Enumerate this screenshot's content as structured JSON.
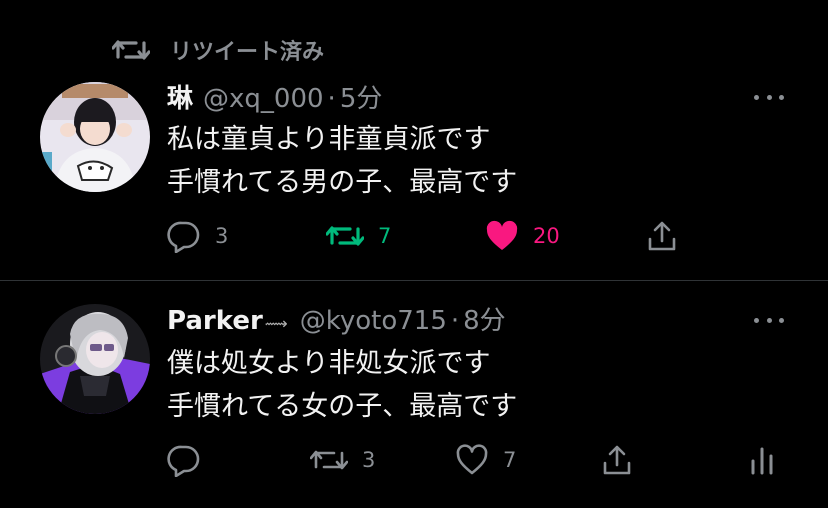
{
  "retweet_banner": {
    "label": "リツイート済み",
    "icon": "retweet-icon"
  },
  "tweets": [
    {
      "name": "琳",
      "name_decoration": "",
      "handle": "@xq_000",
      "separator": "·",
      "time": "5分",
      "lines": [
        "私は童貞より非童貞派です",
        "手慣れてる男の子、最高です"
      ],
      "replies": "3",
      "retweets": "7",
      "likes": "20",
      "retweeted": true,
      "liked": true
    },
    {
      "name": "Parker",
      "name_decoration": "⟿",
      "handle": "@kyoto715",
      "separator": "·",
      "time": "8分",
      "lines": [
        "僕は処女より非処女派です",
        "手慣れてる女の子、最高です"
      ],
      "replies": "",
      "retweets": "3",
      "likes": "7",
      "retweeted": false,
      "liked": false
    }
  ],
  "colors": {
    "background": "#000000",
    "muted": "#8b8f94",
    "retweet_active": "#00ba7c",
    "like_active": "#f91880",
    "divider": "#2f3336"
  }
}
